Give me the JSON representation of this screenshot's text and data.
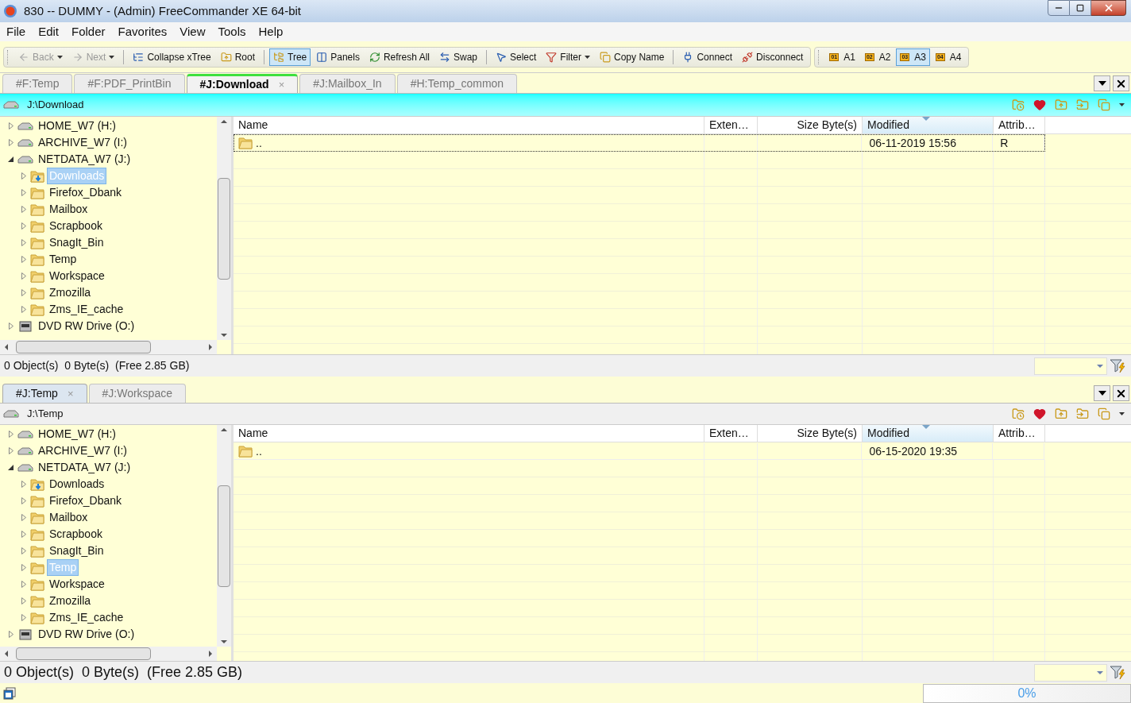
{
  "window": {
    "title": "830 -- DUMMY - (Admin) FreeCommander XE 64-bit"
  },
  "menu": [
    "File",
    "Edit",
    "Folder",
    "Favorites",
    "View",
    "Tools",
    "Help"
  ],
  "toolbars": [
    {
      "items": [
        {
          "kind": "button",
          "label": "Back",
          "disabled": true,
          "dropdown": true,
          "selected": false
        },
        {
          "kind": "button",
          "label": "Next",
          "disabled": true,
          "dropdown": true,
          "selected": false
        },
        {
          "kind": "separator"
        },
        {
          "kind": "button",
          "label": "Collapse xTree",
          "disabled": false,
          "dropdown": false,
          "selected": false
        },
        {
          "kind": "button",
          "label": "Root",
          "disabled": false,
          "dropdown": false,
          "selected": false
        },
        {
          "kind": "separator"
        },
        {
          "kind": "button",
          "label": "Tree",
          "disabled": false,
          "dropdown": false,
          "selected": true
        },
        {
          "kind": "button",
          "label": "Panels",
          "disabled": false,
          "dropdown": false,
          "selected": false
        },
        {
          "kind": "button",
          "label": "Refresh All",
          "disabled": false,
          "dropdown": false,
          "selected": false
        },
        {
          "kind": "button",
          "label": "Swap",
          "disabled": false,
          "dropdown": false,
          "selected": false
        },
        {
          "kind": "separator"
        },
        {
          "kind": "button",
          "label": "Select",
          "disabled": false,
          "dropdown": false,
          "selected": false
        },
        {
          "kind": "button",
          "label": "Filter",
          "disabled": false,
          "dropdown": true,
          "selected": false
        },
        {
          "kind": "button",
          "label": "Copy Name",
          "disabled": false,
          "dropdown": false,
          "selected": false
        },
        {
          "kind": "separator"
        },
        {
          "kind": "button",
          "label": "Connect",
          "disabled": false,
          "dropdown": false,
          "selected": false
        },
        {
          "kind": "button",
          "label": "Disconnect",
          "disabled": false,
          "dropdown": false,
          "selected": false
        }
      ]
    },
    {
      "items": [
        {
          "kind": "badge-button",
          "badge": "01",
          "label": "A1",
          "selected": false
        },
        {
          "kind": "badge-button",
          "badge": "02",
          "label": "A2",
          "selected": false
        },
        {
          "kind": "badge-button",
          "badge": "03",
          "label": "A3",
          "selected": true
        },
        {
          "kind": "badge-button",
          "badge": "04",
          "label": "A4",
          "selected": false
        }
      ]
    }
  ],
  "panels": [
    {
      "active": true,
      "tabs": [
        {
          "label": "#F:Temp",
          "selected": false
        },
        {
          "label": "#F:PDF_PrintBin",
          "selected": false
        },
        {
          "label": "#J:Download",
          "selected": true,
          "close": "×"
        },
        {
          "label": "#J:Mailbox_In",
          "selected": false
        },
        {
          "label": "#H:Temp_common",
          "selected": false
        }
      ],
      "path": "J:\\Download",
      "tree": [
        {
          "kind": "drive",
          "label": "HOME_W7 (H:)",
          "expanded": false,
          "selected": false
        },
        {
          "kind": "drive",
          "label": "ARCHIVE_W7 (I:)",
          "expanded": false,
          "selected": false
        },
        {
          "kind": "drive",
          "label": "NETDATA_W7 (J:)",
          "expanded": true,
          "selected": false,
          "children": [
            {
              "kind": "download-folder",
              "label": "Downloads",
              "expanded": false,
              "selected": true
            },
            {
              "kind": "folder",
              "label": "Firefox_Dbank",
              "expanded": false,
              "selected": false
            },
            {
              "kind": "folder",
              "label": "Mailbox",
              "expanded": false,
              "selected": false
            },
            {
              "kind": "folder",
              "label": "Scrapbook",
              "expanded": false,
              "selected": false
            },
            {
              "kind": "folder",
              "label": "SnagIt_Bin",
              "expanded": false,
              "selected": false
            },
            {
              "kind": "folder",
              "label": "Temp",
              "expanded": false,
              "selected": false
            },
            {
              "kind": "folder",
              "label": "Workspace",
              "expanded": false,
              "selected": false
            },
            {
              "kind": "folder",
              "label": "Zmozilla",
              "expanded": false,
              "selected": false
            },
            {
              "kind": "folder",
              "label": "Zms_IE_cache",
              "expanded": false,
              "selected": false
            }
          ]
        },
        {
          "kind": "dvd",
          "label": "DVD RW Drive (O:)",
          "expanded": false,
          "selected": false
        }
      ],
      "columns": [
        {
          "label": "Name",
          "sorted": false
        },
        {
          "label": "Exten…",
          "sorted": false
        },
        {
          "label": "Size Byte(s)",
          "sorted": false
        },
        {
          "label": "Modified",
          "sorted": true
        },
        {
          "label": "Attrib…",
          "sorted": false
        }
      ],
      "rows": [
        {
          "name": "..",
          "modified": "06-11-2019 15:56",
          "attrib": "R",
          "focused": true
        }
      ],
      "status": "0 Object(s)  0 Byte(s)  (Free 2.85 GB)"
    },
    {
      "active": false,
      "tabs": [
        {
          "label": "#J:Temp",
          "selected": true,
          "close": "×"
        },
        {
          "label": "#J:Workspace",
          "selected": false
        }
      ],
      "path": "J:\\Temp",
      "tree": [
        {
          "kind": "drive",
          "label": "HOME_W7 (H:)",
          "expanded": false,
          "selected": false
        },
        {
          "kind": "drive",
          "label": "ARCHIVE_W7 (I:)",
          "expanded": false,
          "selected": false
        },
        {
          "kind": "drive",
          "label": "NETDATA_W7 (J:)",
          "expanded": true,
          "selected": false,
          "children": [
            {
              "kind": "download-folder",
              "label": "Downloads",
              "expanded": false,
              "selected": false
            },
            {
              "kind": "folder",
              "label": "Firefox_Dbank",
              "expanded": false,
              "selected": false
            },
            {
              "kind": "folder",
              "label": "Mailbox",
              "expanded": false,
              "selected": false
            },
            {
              "kind": "folder",
              "label": "Scrapbook",
              "expanded": false,
              "selected": false
            },
            {
              "kind": "folder",
              "label": "SnagIt_Bin",
              "expanded": false,
              "selected": false
            },
            {
              "kind": "folder",
              "label": "Temp",
              "expanded": false,
              "selected": true
            },
            {
              "kind": "folder",
              "label": "Workspace",
              "expanded": false,
              "selected": false
            },
            {
              "kind": "folder",
              "label": "Zmozilla",
              "expanded": false,
              "selected": false
            },
            {
              "kind": "folder",
              "label": "Zms_IE_cache",
              "expanded": false,
              "selected": false
            }
          ]
        },
        {
          "kind": "dvd",
          "label": "DVD RW Drive (O:)",
          "expanded": false,
          "selected": false
        }
      ],
      "columns": [
        {
          "label": "Name",
          "sorted": false
        },
        {
          "label": "Exten…",
          "sorted": false
        },
        {
          "label": "Size Byte(s)",
          "sorted": false
        },
        {
          "label": "Modified",
          "sorted": true
        },
        {
          "label": "Attrib…",
          "sorted": false
        }
      ],
      "rows": [
        {
          "name": "..",
          "modified": "06-15-2020 19:35",
          "focused": false
        }
      ],
      "status": "0 Object(s)  0 Byte(s)  (Free 2.85 GB)"
    }
  ],
  "progress": {
    "label": "0%",
    "level": 0
  }
}
